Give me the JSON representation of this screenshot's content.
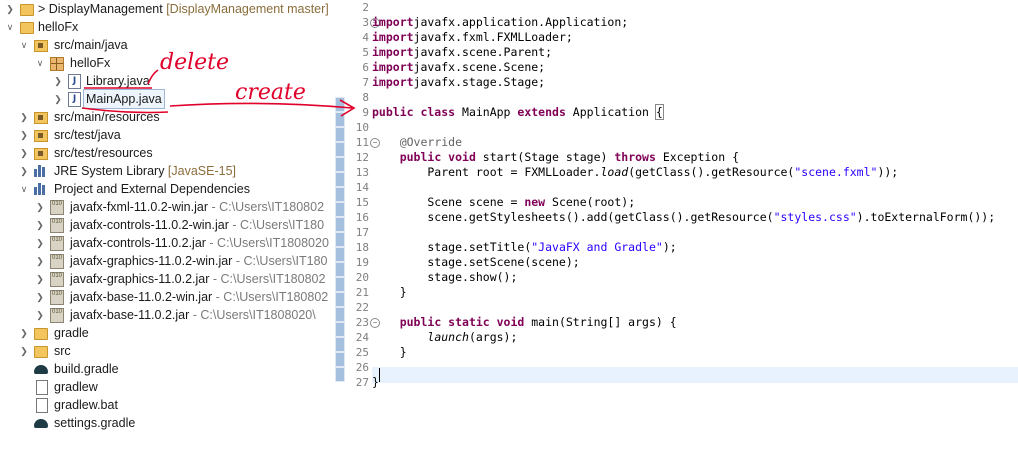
{
  "explorer": {
    "rows": [
      {
        "label": "> DisplayManagement",
        "deco": " [DisplayManagement master]",
        "path": ""
      },
      {
        "label": "helloFx",
        "deco": "",
        "path": ""
      },
      {
        "label": "src/main/java",
        "deco": "",
        "path": ""
      },
      {
        "label": "helloFx",
        "deco": "",
        "path": ""
      },
      {
        "label": "Library.java",
        "deco": "",
        "path": ""
      },
      {
        "label": "MainApp.java",
        "deco": "",
        "path": ""
      },
      {
        "label": "src/main/resources",
        "deco": "",
        "path": ""
      },
      {
        "label": "src/test/java",
        "deco": "",
        "path": ""
      },
      {
        "label": "src/test/resources",
        "deco": "",
        "path": ""
      },
      {
        "label": "JRE System Library",
        "deco": " [JavaSE-15]",
        "path": ""
      },
      {
        "label": "Project and External Dependencies",
        "deco": "",
        "path": ""
      },
      {
        "label": "javafx-fxml-11.0.2-win.jar",
        "deco": "",
        "path": " - C:\\Users\\IT180802"
      },
      {
        "label": "javafx-controls-11.0.2-win.jar",
        "deco": "",
        "path": " - C:\\Users\\IT180"
      },
      {
        "label": "javafx-controls-11.0.2.jar",
        "deco": "",
        "path": " - C:\\Users\\IT1808020"
      },
      {
        "label": "javafx-graphics-11.0.2-win.jar",
        "deco": "",
        "path": " - C:\\Users\\IT180"
      },
      {
        "label": "javafx-graphics-11.0.2.jar",
        "deco": "",
        "path": " - C:\\Users\\IT180802"
      },
      {
        "label": "javafx-base-11.0.2-win.jar",
        "deco": "",
        "path": " - C:\\Users\\IT180802"
      },
      {
        "label": "javafx-base-11.0.2.jar",
        "deco": "",
        "path": " - C:\\Users\\IT1808020\\"
      },
      {
        "label": "gradle",
        "deco": "",
        "path": ""
      },
      {
        "label": "src",
        "deco": "",
        "path": ""
      },
      {
        "label": "build.gradle",
        "deco": "",
        "path": ""
      },
      {
        "label": "gradlew",
        "deco": "",
        "path": ""
      },
      {
        "label": "gradlew.bat",
        "deco": "",
        "path": ""
      },
      {
        "label": "settings.gradle",
        "deco": "",
        "path": ""
      }
    ]
  },
  "editor": {
    "line_numbers": [
      "2",
      "3",
      "4",
      "5",
      "6",
      "7",
      "8",
      "9",
      "10",
      "11",
      "12",
      "13",
      "14",
      "15",
      "16",
      "17",
      "18",
      "19",
      "20",
      "21",
      "22",
      "23",
      "24",
      "25",
      "26",
      "27"
    ],
    "lines": [
      [],
      [
        [
          "kw",
          "import"
        ],
        [
          "",
          "javafx.application.Application;"
        ]
      ],
      [
        [
          "kw",
          "import"
        ],
        [
          "",
          "javafx.fxml.FXMLLoader;"
        ]
      ],
      [
        [
          "kw",
          "import"
        ],
        [
          "",
          "javafx.scene.Parent;"
        ]
      ],
      [
        [
          "kw",
          "import"
        ],
        [
          "",
          "javafx.scene.Scene;"
        ]
      ],
      [
        [
          "kw",
          "import"
        ],
        [
          "",
          "javafx.stage.Stage;"
        ]
      ],
      [],
      [
        [
          "kw",
          "public class"
        ],
        [
          "",
          " MainApp "
        ],
        [
          "kw",
          "extends"
        ],
        [
          "",
          " Application "
        ],
        [
          "br",
          "{"
        ]
      ],
      [],
      [
        [
          "",
          "    "
        ],
        [
          "ann",
          "@Override"
        ]
      ],
      [
        [
          "",
          "    "
        ],
        [
          "kw",
          "public void"
        ],
        [
          "",
          " start(Stage stage) "
        ],
        [
          "kw",
          "throws"
        ],
        [
          "",
          " Exception {"
        ]
      ],
      [
        [
          "",
          "        Parent root = FXMLLoader."
        ],
        [
          "it",
          "load"
        ],
        [
          "",
          "(getClass().getResource("
        ],
        [
          "str",
          "\"scene.fxml\""
        ],
        [
          "",
          "));"
        ]
      ],
      [],
      [
        [
          "",
          "        Scene scene = "
        ],
        [
          "kw",
          "new"
        ],
        [
          "",
          " Scene(root);"
        ]
      ],
      [
        [
          "",
          "        scene.getStylesheets().add(getClass().getResource("
        ],
        [
          "str",
          "\"styles.css\""
        ],
        [
          "",
          ").toExternalForm());"
        ]
      ],
      [],
      [
        [
          "",
          "        stage.setTitle("
        ],
        [
          "str",
          "\"JavaFX and Gradle\""
        ],
        [
          "",
          ");"
        ]
      ],
      [
        [
          "",
          "        stage.setScene(scene);"
        ]
      ],
      [
        [
          "",
          "        stage.show();"
        ]
      ],
      [
        [
          "",
          "    }"
        ]
      ],
      [],
      [
        [
          "",
          "    "
        ],
        [
          "kw",
          "public static void"
        ],
        [
          "",
          " main(String[] args) {"
        ]
      ],
      [
        [
          "",
          "        "
        ],
        [
          "it",
          "launch"
        ],
        [
          "",
          "(args);"
        ]
      ],
      [
        [
          "",
          "    }"
        ]
      ],
      [],
      [
        [
          "",
          "}"
        ]
      ]
    ]
  },
  "annotations": {
    "delete": "delete",
    "create": "create"
  },
  "colors": {
    "annotation": "#e0002a",
    "keyword": "#7f0055",
    "string": "#2a00ff"
  }
}
